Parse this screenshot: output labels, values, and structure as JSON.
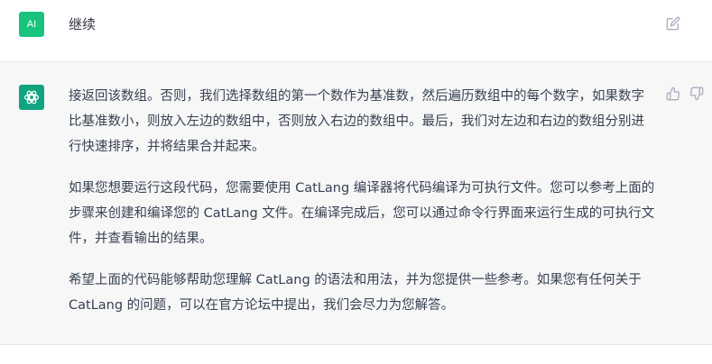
{
  "user_message": {
    "avatar_label": "AI",
    "text": "继续"
  },
  "assistant_message": {
    "paragraphs": [
      "接返回该数组。否则，我们选择数组的第一个数作为基准数，然后遍历数组中的每个数字，如果数字比基准数小，则放入左边的数组中，否则放入右边的数组中。最后，我们对左边和右边的数组分别进行快速排序，并将结果合并起来。",
      "如果您想要运行这段代码，您需要使用 CatLang 编译器将代码编译为可执行文件。您可以参考上面的步骤来创建和编译您的 CatLang 文件。在编译完成后，您可以通过命令行界面来运行生成的可执行文件，并查看输出的结果。",
      "希望上面的代码能够帮助您理解 CatLang 的语法和用法，并为您提供一些参考。如果您有任何关于 CatLang 的问题，可以在官方论坛中提出，我们会尽力为您解答。"
    ]
  },
  "icons": {
    "edit": "edit-icon",
    "thumbs_up": "thumbs-up-icon",
    "thumbs_down": "thumbs-down-icon",
    "assistant_logo": "openai-logo-icon"
  },
  "colors": {
    "user_avatar": "#19c37d",
    "assistant_avatar": "#10a37f",
    "assistant_bg": "#f7f7f8"
  }
}
